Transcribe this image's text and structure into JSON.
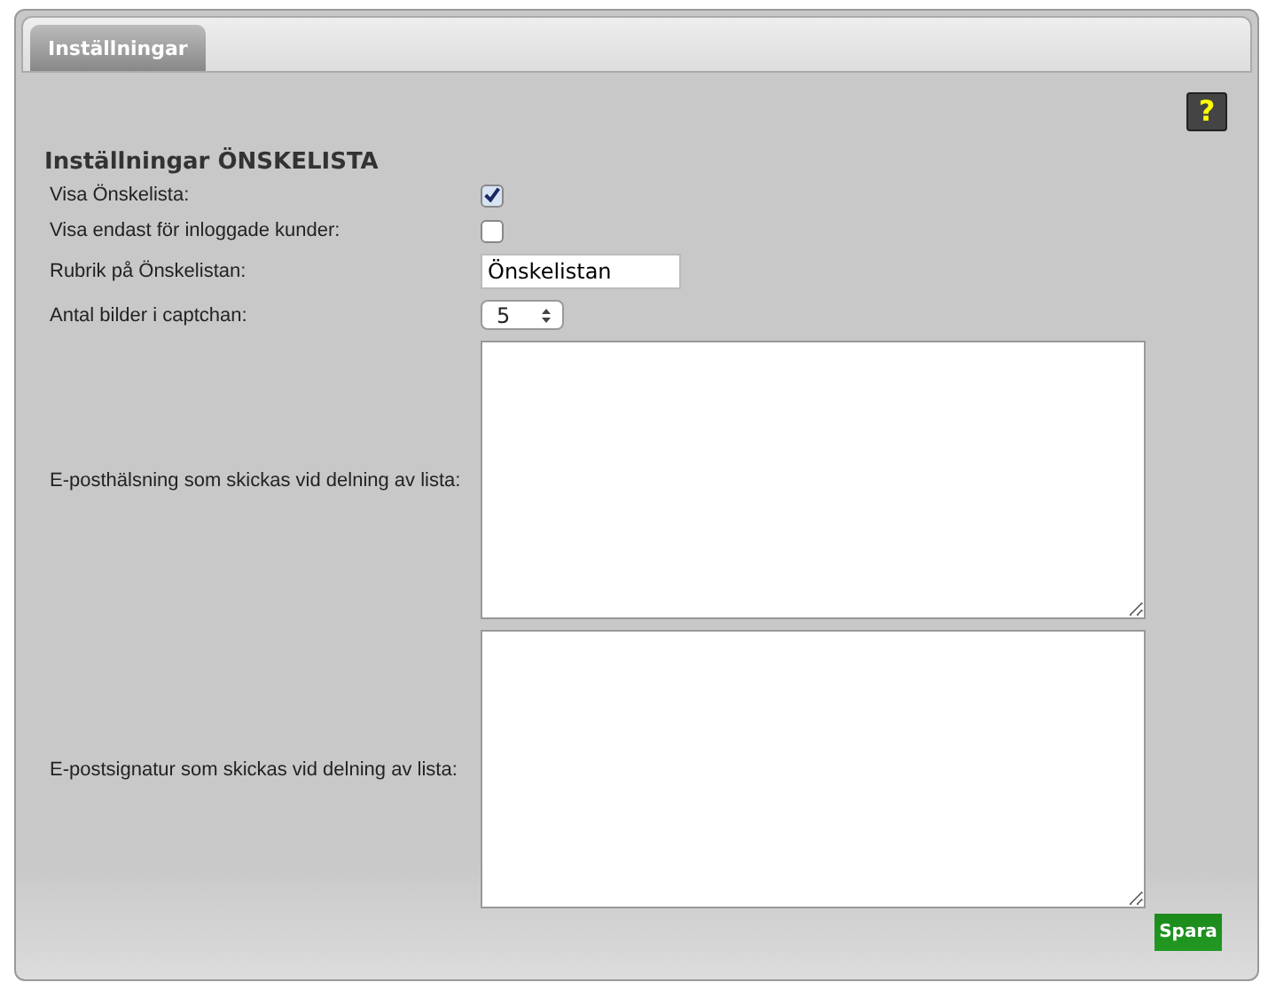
{
  "tabs": [
    {
      "label": "Inställningar",
      "selected": true
    }
  ],
  "help": {
    "label": "?"
  },
  "heading": "Inställningar ÖNSKELISTA",
  "fields": [
    {
      "kind": "checkbox",
      "label": "Visa Önskelista:",
      "checked": true
    },
    {
      "kind": "checkbox",
      "label": "Visa endast för inloggade kunder:",
      "checked": false
    },
    {
      "kind": "text",
      "label": "Rubrik på Önskelistan:",
      "value": "Önskelistan"
    },
    {
      "kind": "select",
      "label": "Antal bilder i captchan:",
      "value": "5"
    },
    {
      "kind": "textarea",
      "label": "E-posthälsning som skickas vid delning av lista:"
    },
    {
      "kind": "textarea",
      "label": "E-postsignatur som skickas vid delning av lista:"
    }
  ],
  "buttons": [
    {
      "label": "Spara"
    }
  ]
}
